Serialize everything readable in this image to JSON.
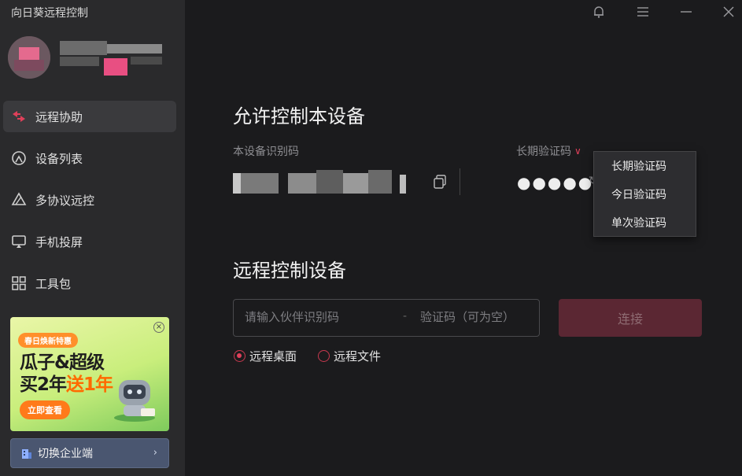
{
  "app": {
    "title": "向日葵远程控制"
  },
  "sidebar": {
    "items": [
      {
        "label": "远程协助",
        "icon": "remote-assist-icon",
        "active": true
      },
      {
        "label": "设备列表",
        "icon": "device-list-icon",
        "active": false
      },
      {
        "label": "多协议远控",
        "icon": "multi-protocol-icon",
        "active": false
      },
      {
        "label": "手机投屏",
        "icon": "screen-cast-icon",
        "active": false
      },
      {
        "label": "工具包",
        "icon": "toolkit-icon",
        "active": false
      }
    ],
    "ad": {
      "tag": "春日焕新特惠",
      "line1": "瓜子&超级",
      "line2_a": "买2年",
      "line2_b": "送1年",
      "button": "立即查看",
      "close": "×"
    },
    "switch_label": "切换企业端"
  },
  "allow": {
    "title": "允许控制本设备",
    "device_id_label": "本设备识别码",
    "code_type_label": "长期验证码",
    "password_mask": "●●●●●●"
  },
  "dropdown": {
    "options": [
      "长期验证码",
      "今日验证码",
      "单次验证码"
    ]
  },
  "remote": {
    "title": "远程控制设备",
    "partner_placeholder": "请输入伙伴识别码",
    "separator": "-",
    "code_placeholder": "验证码（可为空）",
    "connect_label": "连接",
    "modes": [
      {
        "label": "远程桌面",
        "selected": true
      },
      {
        "label": "远程文件",
        "selected": false
      }
    ]
  },
  "colors": {
    "accent": "#e0405a",
    "sidebar": "#2a2a2c",
    "main": "#1b1b1d"
  }
}
